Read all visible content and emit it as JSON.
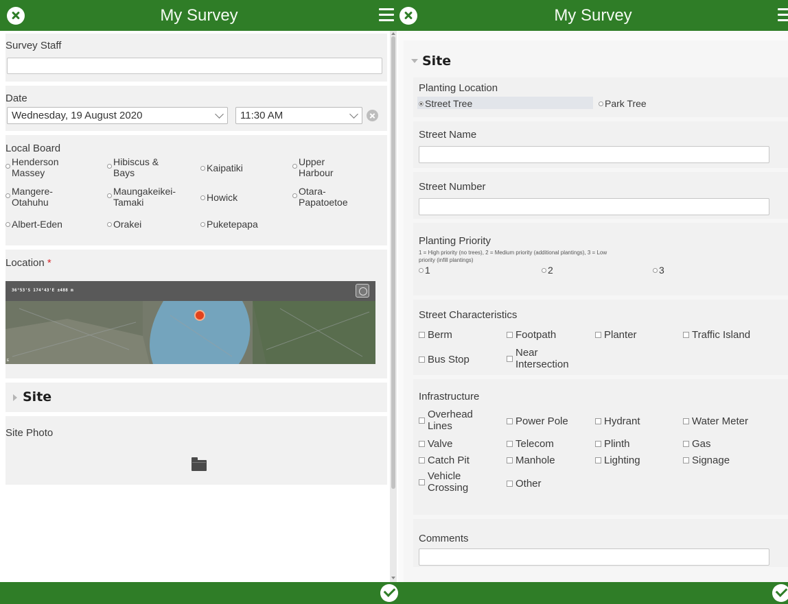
{
  "colors": {
    "brand": "#2f7d27",
    "section_bg": "#f1f1f1",
    "required": "#d7262a"
  },
  "left": {
    "title": "My Survey",
    "survey_staff": {
      "label": "Survey Staff",
      "value": ""
    },
    "date": {
      "label": "Date",
      "date_value": "Wednesday, 19 August 2020",
      "time_value": "11:30 AM"
    },
    "local_board": {
      "label": "Local Board",
      "options": [
        {
          "line1": "Henderson",
          "line2": "Massey"
        },
        {
          "line1": "Hibiscus &",
          "line2": "Bays"
        },
        {
          "line1": "Kaipatiki",
          "line2": ""
        },
        {
          "line1": "Upper",
          "line2": "Harbour"
        },
        {
          "line1": "Mangere-",
          "line2": "Otahuhu"
        },
        {
          "line1": "Maungakeikei-",
          "line2": "Tamaki"
        },
        {
          "line1": "Howick",
          "line2": ""
        },
        {
          "line1": "Otara-",
          "line2": "Papatoetoe"
        },
        {
          "line1": "Albert-Eden",
          "line2": ""
        },
        {
          "line1": "Orakei",
          "line2": ""
        },
        {
          "line1": "Puketepapa",
          "line2": ""
        }
      ]
    },
    "location": {
      "label": "Location",
      "required_mark": "*",
      "coords": "36°53'S 174°43'E ±488 m"
    },
    "site_group": {
      "label": "Site"
    },
    "site_photo": {
      "label": "Site Photo"
    }
  },
  "right": {
    "title": "My Survey",
    "site_group": {
      "label": "Site"
    },
    "planting_location": {
      "label": "Planting Location",
      "options": [
        "Street Tree",
        "Park Tree"
      ],
      "selected": "Street Tree"
    },
    "street_name": {
      "label": "Street Name",
      "value": ""
    },
    "street_number": {
      "label": "Street Number",
      "value": ""
    },
    "planting_priority": {
      "label": "Planting Priority",
      "hint_line1": "1 = High priority (no trees), 2 = Medium priority (additional plantings), 3 = Low",
      "hint_line2": "priority (infill plantings)",
      "options": [
        "1",
        "2",
        "3"
      ]
    },
    "street_characteristics": {
      "label": "Street Characteristics",
      "options": [
        {
          "line1": "Berm",
          "line2": ""
        },
        {
          "line1": "Footpath",
          "line2": ""
        },
        {
          "line1": "Planter",
          "line2": ""
        },
        {
          "line1": "Traffic Island",
          "line2": ""
        },
        {
          "line1": "Bus Stop",
          "line2": ""
        },
        {
          "line1": "Near",
          "line2": "Intersection"
        }
      ]
    },
    "infrastructure": {
      "label": "Infrastructure",
      "options": [
        {
          "line1": "Overhead",
          "line2": "Lines"
        },
        {
          "line1": "Power Pole",
          "line2": ""
        },
        {
          "line1": "Hydrant",
          "line2": ""
        },
        {
          "line1": "Water Meter",
          "line2": ""
        },
        {
          "line1": "Valve",
          "line2": ""
        },
        {
          "line1": "Telecom",
          "line2": ""
        },
        {
          "line1": "Plinth",
          "line2": ""
        },
        {
          "line1": "Gas",
          "line2": ""
        },
        {
          "line1": "Catch Pit",
          "line2": ""
        },
        {
          "line1": "Manhole",
          "line2": ""
        },
        {
          "line1": "Lighting",
          "line2": ""
        },
        {
          "line1": "Signage",
          "line2": ""
        },
        {
          "line1": "Vehicle",
          "line2": "Crossing"
        },
        {
          "line1": "Other",
          "line2": ""
        }
      ]
    },
    "comments": {
      "label": "Comments",
      "value": ""
    }
  }
}
